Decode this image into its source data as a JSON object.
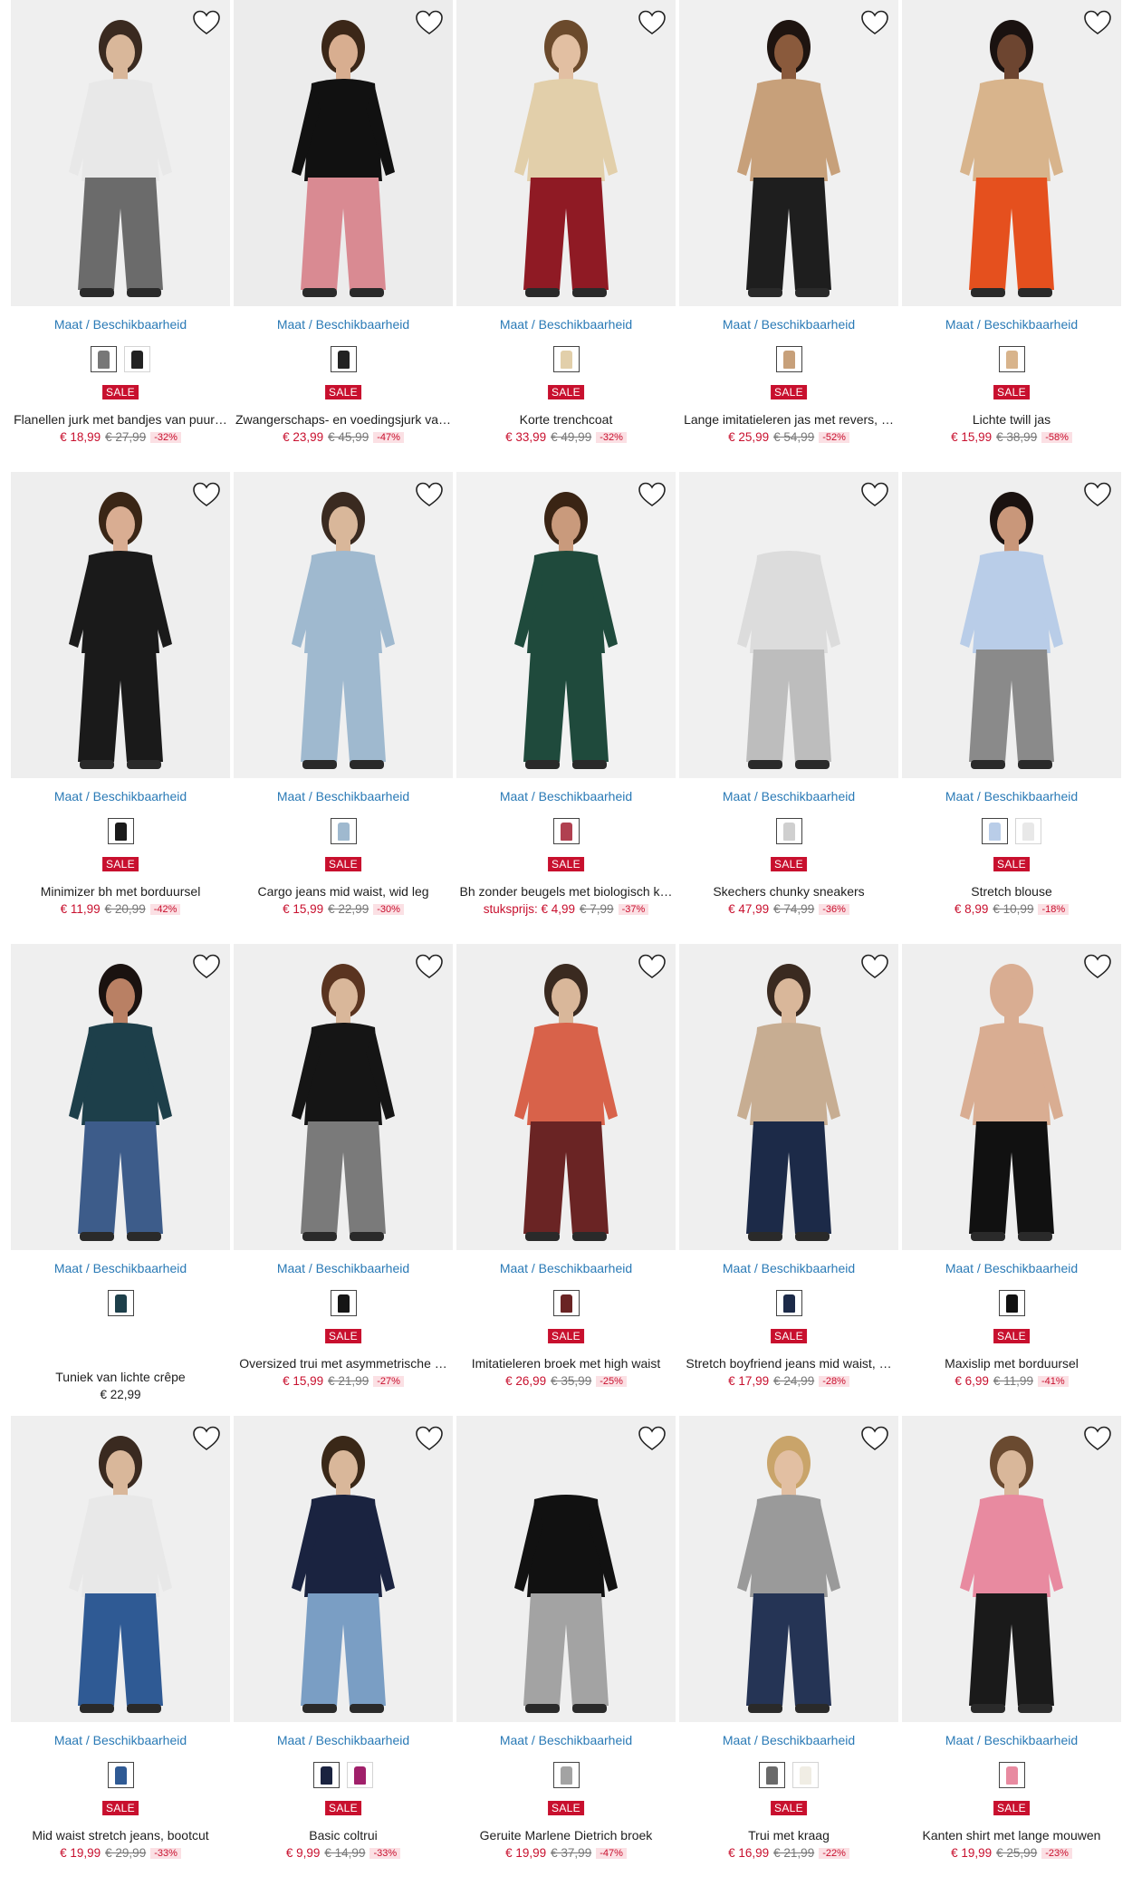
{
  "labels": {
    "maat": "Maat / Beschikbaarheid",
    "sale": "SALE"
  },
  "colors": {
    "sale": "#c8102e",
    "link": "#2a7ab6",
    "discount_bg": "#fbe0e4"
  },
  "products": [
    {
      "name": "Flanellen jurk met bandjes van puur…",
      "price": "€ 18,99",
      "old": "€ 27,99",
      "pct": "-32%",
      "bg": "#efefef",
      "top": "#e8e8e8",
      "bottom": "#6b6b6b",
      "skin": "#d9b79a",
      "hair": "#3a2a20",
      "swatches": [
        "#777",
        "#222"
      ]
    },
    {
      "name": "Zwangerschaps- en voedingsjurk va…",
      "price": "€ 23,99",
      "old": "€ 45,99",
      "pct": "-47%",
      "bg": "#ececec",
      "top": "#111111",
      "bottom": "#d98a92",
      "skin": "#d8ae90",
      "hair": "#3b2718",
      "swatches": [
        "#222"
      ]
    },
    {
      "name": "Korte trenchcoat",
      "price": "€ 33,99",
      "old": "€ 49,99",
      "pct": "-32%",
      "bg": "#efefef",
      "top": "#e2cfaa",
      "bottom": "#8f1a24",
      "skin": "#e2bfa2",
      "hair": "#6b4a2c",
      "swatches": [
        "#e2cfaa"
      ]
    },
    {
      "name": "Lange imitatieleren jas met revers, …",
      "price": "€ 25,99",
      "old": "€ 54,99",
      "pct": "-52%",
      "bg": "#f0f0f0",
      "top": "#c7a07a",
      "bottom": "#1e1e1e",
      "skin": "#8a5a3c",
      "hair": "#1e1410",
      "swatches": [
        "#c7a07a"
      ]
    },
    {
      "name": "Lichte twill jas",
      "price": "€ 15,99",
      "old": "€ 38,99",
      "pct": "-58%",
      "bg": "#efefef",
      "top": "#d8b48c",
      "bottom": "#e5501e",
      "skin": "#6d4530",
      "hair": "#1a1210",
      "swatches": [
        "#d8b48c"
      ]
    },
    {
      "name": "Minimizer bh met borduursel",
      "price": "€ 11,99",
      "old": "€ 20,99",
      "pct": "-42%",
      "bg": "#eeeeee",
      "top": "#1a1a1a",
      "bottom": "#1a1a1a",
      "skin": "#d9ad92",
      "hair": "#3a2616",
      "swatches": [
        "#1a1a1a"
      ]
    },
    {
      "name": "Cargo jeans mid waist, wid leg",
      "price": "€ 15,99",
      "old": "€ 22,99",
      "pct": "-30%",
      "bg": "#f0f0f0",
      "top": "#9fb9cf",
      "bottom": "#9fb9cf",
      "skin": "#d9b79a",
      "hair": "#3a2a20",
      "swatches": [
        "#9fb9cf"
      ]
    },
    {
      "name": "Bh zonder beugels met biologisch k…",
      "price": "stuksprijs: € 4,99",
      "old": "€ 7,99",
      "pct": "-37%",
      "bg": "#f2f2f2",
      "top": "#1f4a3c",
      "bottom": "#1f4a3c",
      "skin": "#c99a7c",
      "hair": "#3a2414",
      "swatches": [
        "#b04050"
      ]
    },
    {
      "name": "Skechers chunky sneakers",
      "price": "€ 47,99",
      "old": "€ 74,99",
      "pct": "-36%",
      "bg": "#f0f0f0",
      "top": "#dcdcdc",
      "bottom": "#bdbdbd",
      "skin": "#f0f0f0",
      "hair": "#f0f0f0",
      "swatches": [
        "#cfcfcf"
      ]
    },
    {
      "name": "Stretch blouse",
      "price": "€ 8,99",
      "old": "€ 10,99",
      "pct": "-18%",
      "bg": "#efefef",
      "top": "#b9cde8",
      "bottom": "#8a8a8a",
      "skin": "#c9977a",
      "hair": "#1a1210",
      "swatches": [
        "#b9cde8",
        "#e8e8e8"
      ]
    },
    {
      "name": "Tuniek van lichte crêpe",
      "price": "€ 22,99",
      "old": "",
      "pct": "",
      "nosale": true,
      "bg": "#efefef",
      "top": "#1d3f4a",
      "bottom": "#3d5c8a",
      "skin": "#b98064",
      "hair": "#1a1210",
      "swatches": [
        "#1d3f4a"
      ]
    },
    {
      "name": "Oversized trui met asymmetrische …",
      "price": "€ 15,99",
      "old": "€ 21,99",
      "pct": "-27%",
      "bg": "#efefef",
      "top": "#151515",
      "bottom": "#7a7a7a",
      "skin": "#d9b79a",
      "hair": "#5a3420",
      "swatches": [
        "#151515"
      ]
    },
    {
      "name": "Imitatieleren broek met high waist",
      "price": "€ 26,99",
      "old": "€ 35,99",
      "pct": "-25%",
      "bg": "#efefef",
      "top": "#d8624a",
      "bottom": "#6a2424",
      "skin": "#d9b79a",
      "hair": "#3a2a20",
      "swatches": [
        "#6a2424"
      ]
    },
    {
      "name": "Stretch boyfriend jeans mid waist, …",
      "price": "€ 17,99",
      "old": "€ 24,99",
      "pct": "-28%",
      "bg": "#efefef",
      "top": "#c7ad92",
      "bottom": "#1c2a48",
      "skin": "#d9b79a",
      "hair": "#3a2a20",
      "swatches": [
        "#1c2a48"
      ]
    },
    {
      "name": "Maxislip met borduursel",
      "price": "€ 6,99",
      "old": "€ 11,99",
      "pct": "-41%",
      "bg": "#efefef",
      "top": "#d9ad92",
      "bottom": "#111111",
      "skin": "#d9ad92",
      "hair": "#d9ad92",
      "swatches": [
        "#111111"
      ]
    },
    {
      "name": "Mid waist stretch jeans, bootcut",
      "price": "€ 19,99",
      "old": "€ 29,99",
      "pct": "-33%",
      "bg": "#efefef",
      "top": "#e8e8e8",
      "bottom": "#2f5a94",
      "skin": "#d9b79a",
      "hair": "#3a2a20",
      "swatches": [
        "#2f5a94"
      ]
    },
    {
      "name": "Basic coltrui",
      "price": "€ 9,99",
      "old": "€ 14,99",
      "pct": "-33%",
      "bg": "#efefef",
      "top": "#1a2340",
      "bottom": "#7a9ec4",
      "skin": "#d9b79a",
      "hair": "#3a2818",
      "swatches": [
        "#1a2340",
        "#a0206a"
      ]
    },
    {
      "name": "Geruite Marlene Dietrich broek",
      "price": "€ 19,99",
      "old": "€ 37,99",
      "pct": "-47%",
      "bg": "#efefef",
      "top": "#111111",
      "bottom": "#a3a3a3",
      "skin": "#efefef",
      "hair": "#efefef",
      "swatches": [
        "#a3a3a3"
      ]
    },
    {
      "name": "Trui met kraag",
      "price": "€ 16,99",
      "old": "€ 21,99",
      "pct": "-22%",
      "bg": "#efefef",
      "top": "#9a9a9a",
      "bottom": "#253455",
      "skin": "#e2bfa2",
      "hair": "#c9a46a",
      "swatches": [
        "#6a6a6a",
        "#f0ede4"
      ]
    },
    {
      "name": "Kanten shirt met lange mouwen",
      "price": "€ 19,99",
      "old": "€ 25,99",
      "pct": "-23%",
      "bg": "#efefef",
      "top": "#e88aa0",
      "bottom": "#1a1a1a",
      "skin": "#d9b79a",
      "hair": "#6a4a30",
      "swatches": [
        "#e88aa0"
      ]
    }
  ]
}
